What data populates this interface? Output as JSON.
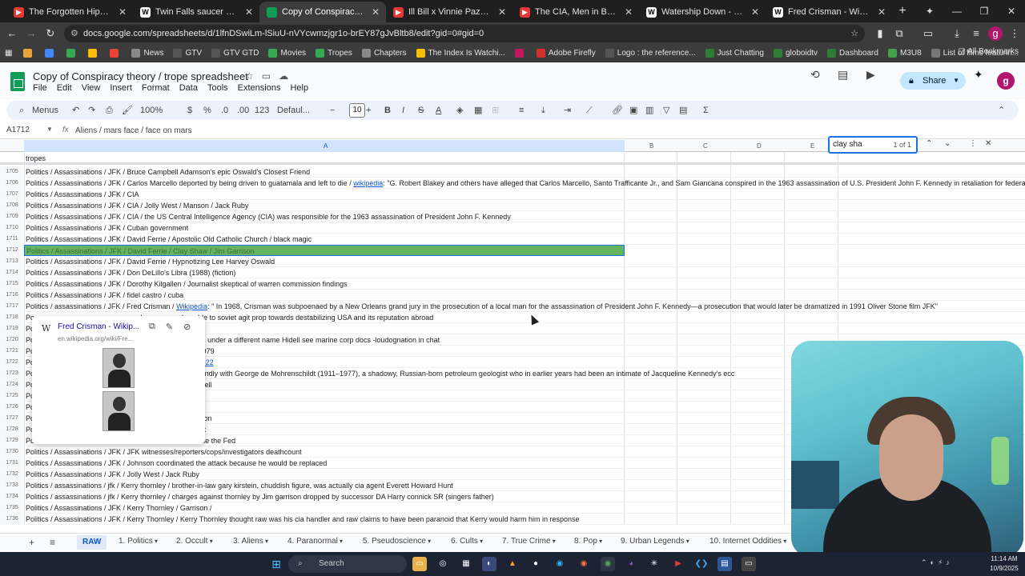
{
  "browser": {
    "tabs": [
      {
        "title": "The Forgotten Hippie Terror Cu",
        "icon": "youtube-icon",
        "color": "#e53935"
      },
      {
        "title": "Twin Falls saucer hoax - Wikipe",
        "icon": "wikipedia-icon",
        "color": "#ffffff"
      },
      {
        "title": "Copy of Conspiracy theory / tr",
        "icon": "sheets-icon",
        "color": "#0f9d58",
        "active": true
      },
      {
        "title": "Ill Bill x Vinnie Paz - Heavy Me",
        "icon": "youtube-icon",
        "color": "#e53935"
      },
      {
        "title": "The CIA, Men in Black and the",
        "icon": "youtube-icon",
        "color": "#e53935"
      },
      {
        "title": "Watership Down - Wikipedia",
        "icon": "wikipedia-icon",
        "color": "#ffffff"
      },
      {
        "title": "Fred Crisman - Wikipedia",
        "icon": "wikipedia-icon",
        "color": "#ffffff"
      }
    ],
    "url": "docs.google.com/spreadsheets/d/1lfnDSwiLm-lSiuU-nVYcwmzjgr1o-brEY87gJvBltb8/edit?gid=0#gid=0",
    "bookmarks": [
      {
        "label": "",
        "color": "#e8a33d"
      },
      {
        "label": "",
        "color": "#4285f4"
      },
      {
        "label": "",
        "color": "#34a853"
      },
      {
        "label": "",
        "color": "#fbbc04"
      },
      {
        "label": "",
        "color": "#ea4335"
      },
      {
        "label": "News",
        "color": "#888888"
      },
      {
        "label": "GTV",
        "color": "#555555"
      },
      {
        "label": "GTV GTD",
        "color": "#555555"
      },
      {
        "label": "Movies",
        "color": "#34a853"
      },
      {
        "label": "Tropes",
        "color": "#34a853"
      },
      {
        "label": "Chapters",
        "color": "#888888"
      },
      {
        "label": "The Index Is Watchi...",
        "color": "#fbbc04"
      },
      {
        "label": "",
        "color": "#c2185b"
      },
      {
        "label": "Adobe Firefly",
        "color": "#d32f2f"
      },
      {
        "label": "Logo : the reference...",
        "color": "#555555"
      },
      {
        "label": "Just Chatting",
        "color": "#2e7d32"
      },
      {
        "label": "globoidtv",
        "color": "#2e7d32"
      },
      {
        "label": "Dashboard",
        "color": "#2e7d32"
      },
      {
        "label": "M3U8",
        "color": "#43a047"
      },
      {
        "label": "List of films featurin...",
        "color": "#777777"
      }
    ],
    "all_bookmarks": "All Bookmarks"
  },
  "sheets": {
    "title": "Copy of Conspiracy theory / trope spreadsheet",
    "menu": [
      "File",
      "Edit",
      "View",
      "Insert",
      "Format",
      "Data",
      "Tools",
      "Extensions",
      "Help"
    ],
    "share_label": "Share",
    "avatar_letter": "g",
    "toolbar": {
      "menus": "Menus",
      "zoom": "100%",
      "currency": "$",
      "percent": "%",
      "dec_less": ".0",
      "dec_more": ".00",
      "num_format": "123",
      "font": "Defaul...",
      "font_size": "10",
      "bold": "B",
      "italic": "I",
      "strike": "S",
      "textcolor": "A"
    },
    "name_box": "A1712",
    "fx": "fx",
    "formula": "Aliens / mars face / face on mars",
    "columns": [
      "A",
      "B",
      "C",
      "D",
      "E"
    ],
    "frozen_row_label": "tropes",
    "find": {
      "query": "clay sha",
      "count": "1 of 1"
    },
    "rows": [
      {
        "n": "1705",
        "text": "Politics / Assassinations / JFK / Bruce Campbell Adamson's epic Oswald's Closest Friend"
      },
      {
        "n": "1706",
        "text": "Politics / Assassinations / JFK / Carlos Marcello deported by being driven to guatamala and left to die / ",
        "link": "wikipedia",
        "after": ": \"G. Robert Blakey and others have alleged that Carlos Marcello, Santo Trafficante Jr., and Sam Giancana conspired in the 1963 assassination of U.S. President John F. Kennedy in retaliation for federal i"
      },
      {
        "n": "1707",
        "text": "Politics / Assassinations / JFK / CIA"
      },
      {
        "n": "1708",
        "text": "Politics / Assassinations / JFK / CIA / Jolly West / Manson / Jack Ruby"
      },
      {
        "n": "1709",
        "text": "Politics / Assassinations / JFK / CIA / the US Central Intelligence Agency (CIA) was responsible for the 1963 assassination of President John F. Kennedy"
      },
      {
        "n": "1710",
        "text": "Politics / Assassinations / JFK / Cuban government"
      },
      {
        "n": "1711",
        "text": "Politics / Assassinations / JFK / David Ferrie / Apostolic Old Catholic Church / black magic"
      },
      {
        "n": "1712",
        "text": "Politics / Assassinations / JFK / David Ferrie / Clay Shaw / Jim Garrison",
        "highlight": true
      },
      {
        "n": "1713",
        "text": "Politics / Assassinations / JFK / David Ferrie / Hypnotizing Lee Harvey Oswald"
      },
      {
        "n": "1714",
        "text": "Politics / Assassinations / JFK / Don DeLillo's Libra (1988) (fiction)"
      },
      {
        "n": "1715",
        "text": "Politics / Assassinations / JFK / Dorothy Kilgallen / Journalist skeptical of warren commission findings"
      },
      {
        "n": "1716",
        "text": "Politics / Assassinations / JFK / fidel castro / cuba"
      },
      {
        "n": "1717",
        "text": "Politics / assassinations / JFK / Fred Crisman / ",
        "link": "Wikipedia",
        "after": ": \" In 1968, Crisman was subpoenaed by a New Orleans grand jury in the prosecution of a local man for the assassination of President John F. Kennedy—a prosecution that would later be dramatized in 1991 Oliver Stone film JFK\""
      },
      {
        "n": "1718",
        "text": "Po                                                  rchers were vulnerable to soviet agit prop towards destabilizing USA and its reputation abroad"
      },
      {
        "n": "1719",
        "text": "Po"
      },
      {
        "n": "1720",
        "text": "Po                                                  l into the marine corps under a different name Hidell see marine corp docs -loudognation in chat"
      },
      {
        "n": "1721",
        "text": "Po                                                  on Assassinations / 1979"
      },
      {
        "n": "1722",
        "text": "Po                                                  ",
        "link": "research/jfk/release2022",
        "after": ""
      },
      {
        "n": "1723",
        "text": "Po                                                  ald would become friendly with George de Mohrenschildt (1911–1977), a shadowy, Russian-born petroleum geologist who in earlier years had been an intimate of Jacqueline Kennedy's ecc"
      },
      {
        "n": "1724",
        "text": "Po                                                  ncana / Judith Campbell"
      },
      {
        "n": "1725",
        "text": "Po                                                  mind control"
      },
      {
        "n": "1726",
        "text": "Po                                                  could get nukes"
      },
      {
        "n": "1727",
        "text": "Po                                                  an behind assassination"
      },
      {
        "n": "1728",
        "text": "Po                                                  aeli nuclear armament"
      },
      {
        "n": "1729",
        "text": "Po                                                  se he tried to dismantle the Fed"
      },
      {
        "n": "1730",
        "text": "Politics / Assassinations / JFK / JFK witnesses/reporters/cops/investigators deathcount"
      },
      {
        "n": "1731",
        "text": "Politics / Assassinations / JFK / Johnson coordinated the attack because he would be replaced"
      },
      {
        "n": "1732",
        "text": "Politics / Assassinations / JFK / Jolly West / Jack Ruby"
      },
      {
        "n": "1733",
        "text": "Politics / assassinations / jfk / Kerry thornley / brother-in-law gary kirstein, chuddish figure, was actually cia agent Everett Howard Hunt"
      },
      {
        "n": "1734",
        "text": "Politics / assassinations / jfk / Kerry thornley / charges against thornley by Jim garrison dropped by successor DA Harry connick SR (singers father)"
      },
      {
        "n": "1735",
        "text": "Politics / Assassinations / JFK / Kerry Thornley / Garrison /"
      },
      {
        "n": "1736",
        "text": "Politics / Assassinations / JFK / Kerry Thornley / Kerry Thornley thought raw was his cia handler and raw claims to have been paranoid that Kerry would harm him in response"
      }
    ],
    "link_card": {
      "title": "Fred Crisman - Wikip...",
      "url": "en.wikipedia.org/wiki/Fre..."
    },
    "sheet_tabs": [
      "RAW",
      "1. Politics",
      "2. Occult",
      "3. Aliens",
      "4. Paranormal",
      "5. Pseudoscience",
      "6. Cults",
      "7. True Crime",
      "8. Pop",
      "9. Urban Legends",
      "10. Internet Oddities"
    ]
  },
  "taskbar": {
    "search_placeholder": "Search",
    "time": "11:14 AM",
    "date": "10/9/2025"
  }
}
